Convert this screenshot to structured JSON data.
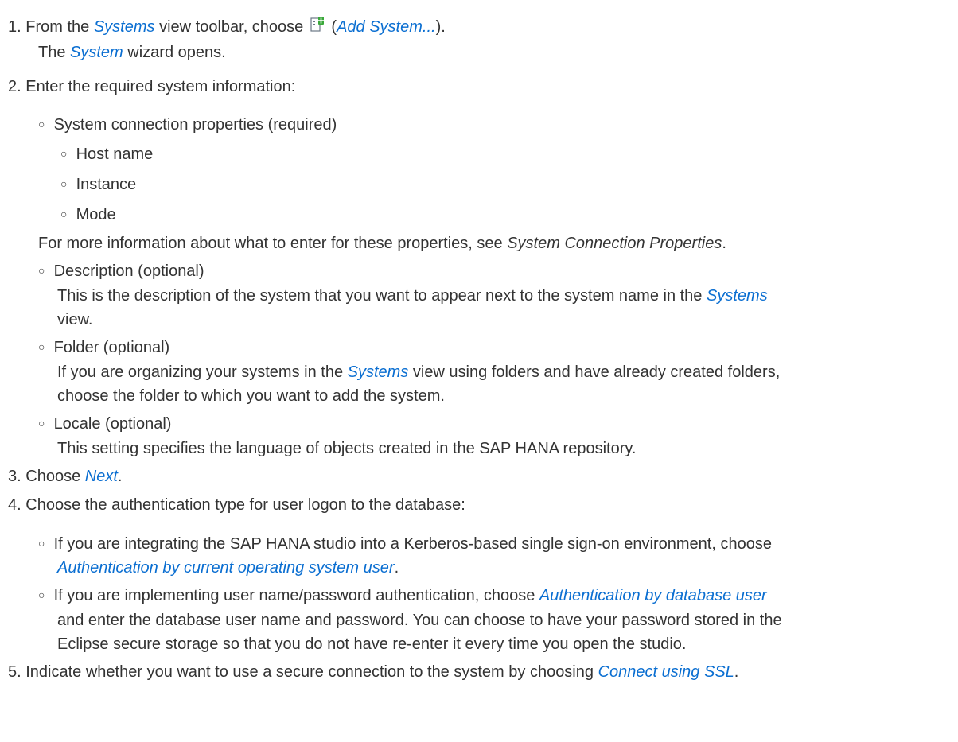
{
  "steps": {
    "s1": {
      "num": "1.",
      "pre": "From the ",
      "link1": "Systems",
      "mid": " view toolbar, choose ",
      "icon": "add-system-icon",
      "paren_open": " (",
      "link2": "Add System...",
      "paren_close": ").",
      "line2_pre": "The ",
      "line2_link": "System",
      "line2_post": " wizard opens."
    },
    "s2": {
      "num": "2.",
      "text": "Enter the required system information:"
    },
    "s3": {
      "num": "3.",
      "pre": "Choose ",
      "link": "Next",
      "post": "."
    },
    "s4": {
      "num": "4.",
      "text": "Choose the authentication type for user logon to the database:"
    },
    "s5": {
      "num": "5.",
      "pre": "Indicate whether you want to use a secure connection to the system by choosing ",
      "link": "Connect using SSL",
      "post": "."
    }
  },
  "system_info": {
    "bullet": "○",
    "connection": {
      "label": "System connection properties (required)",
      "sub": [
        "Host name",
        "Instance",
        "Mode"
      ],
      "note_pre": "For more information about what to enter for these properties, see ",
      "note_em": "System Connection Properties",
      "note_post": "."
    },
    "description": {
      "label": "Description (optional)",
      "line1_pre": "This is the description of the system that you want to appear next to the system name in the ",
      "line1_link": "Systems",
      "line2": "view."
    },
    "folder": {
      "label": "Folder (optional)",
      "line1_pre": "If you are organizing your systems in the ",
      "line1_link": "Systems",
      "line1_post": " view using folders and have already created folders,",
      "line2": "choose the folder to which you want to add the system."
    },
    "locale": {
      "label": "Locale (optional)",
      "line1": "This setting specifies the language of objects created in the SAP HANA repository."
    }
  },
  "auth": {
    "kerberos": {
      "line1": "If you are integrating the SAP HANA studio into a Kerberos-based single sign-on environment, choose",
      "line2_link": "Authentication by current operating system user",
      "line2_post": "."
    },
    "userpass": {
      "line1_pre": "If you are implementing user name/password authentication, choose ",
      "line1_link": "Authentication by database user",
      "line2": "and enter the database user name and password. You can choose to have your password stored in the",
      "line3": "Eclipse secure storage so that you do not have re-enter it every time you open the studio."
    }
  },
  "colors": {
    "text": "#333333",
    "link": "#0a6ed1",
    "icon_green": "#3aa83a",
    "icon_page": "#ffffff"
  }
}
